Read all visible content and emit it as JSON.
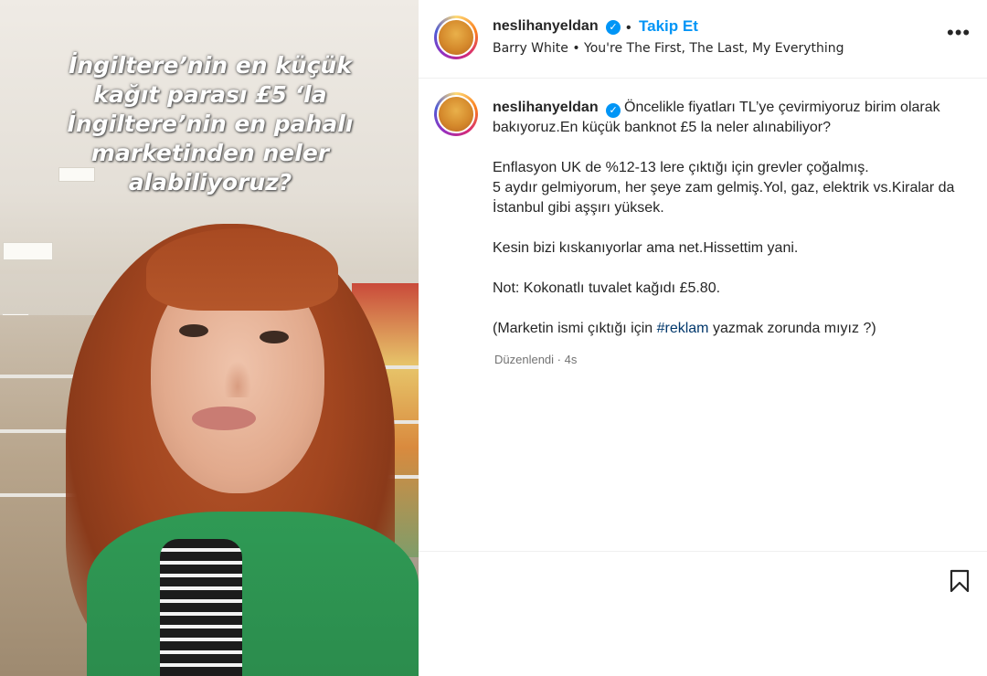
{
  "media": {
    "overlay_text": "İngiltere’nin en küçük\nkağıt parası £5 ‘la\nİngiltere’nin en pahalı\nmarketinden neler\nalabiliyoruz?"
  },
  "header": {
    "username": "neslihanyeldan",
    "separator": "•",
    "follow_label": "Takip Et",
    "song": "Barry White • You're The First, The Last, My Everything",
    "more_label": "•••"
  },
  "caption": {
    "username": "neslihanyeldan",
    "line1": "Öncelikle fiyatları TL’ye çevirmiyoruz birim olarak bakıyoruz.En küçük banknot £5 la neler alınabiliyor?",
    "para2": "Enflasyon UK de %12-13 lere çıktığı için grevler çoğalmış.\n5 aydır gelmiyorum, her şeye zam gelmiş.Yol, gaz, elektrik vs.Kiralar da İstanbul gibi aşşırı yüksek.",
    "para3": "Kesin bizi kıskanıyorlar ama net.Hissettim yani.",
    "para4": "Not: Kokonatlı tuvalet kağıdı £5.80.",
    "para5_before": "(Marketin ismi çıktığı için ",
    "para5_hashtag": "#reklam",
    "para5_after": " yazmak zorunda mıyız ?)"
  },
  "meta": {
    "edited": "Düzenlendi",
    "separator": " · ",
    "time": "4s"
  },
  "colors": {
    "accent": "#0095f6",
    "hashtag": "#00376b",
    "muted": "#737373"
  },
  "icons": {
    "verified": "verified-badge-icon",
    "more": "more-options-icon",
    "bookmark": "bookmark-icon"
  }
}
